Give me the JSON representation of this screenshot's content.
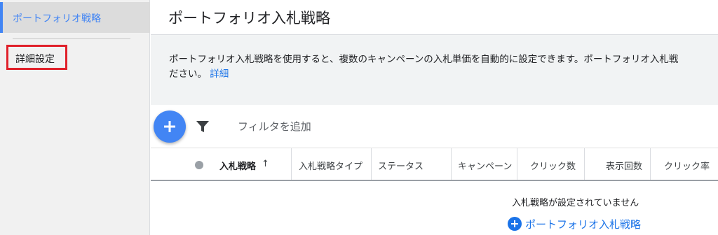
{
  "sidebar": {
    "items": [
      {
        "label": "ポートフォリオ戦略",
        "active": true
      },
      {
        "label": "詳細設定",
        "highlighted": true
      }
    ]
  },
  "header": {
    "title": "ポートフォリオ入札戦略"
  },
  "info": {
    "line1": "ポートフォリオ入札戦略を使用すると、複数のキャンペーンの入札単価を自動的に設定できます。ポートフォリオ入札戦",
    "line2": "ださい。",
    "link": "詳細"
  },
  "toolbar": {
    "add_icon": "plus-icon",
    "filter_icon": "filter-icon",
    "filter_text": "フィルタを追加"
  },
  "table": {
    "columns": [
      "入札戦略",
      "入札戦略タイプ",
      "ステータス",
      "キャンペーン",
      "クリック数",
      "表示回数",
      "クリック率"
    ],
    "sort_indicator": "↑",
    "empty_message": "入札戦略が設定されていません",
    "add_label": "ポートフォリオ入札戦略"
  },
  "colors": {
    "accent": "#4285f4",
    "link": "#1a73e8",
    "highlight_border": "#e0202a"
  }
}
